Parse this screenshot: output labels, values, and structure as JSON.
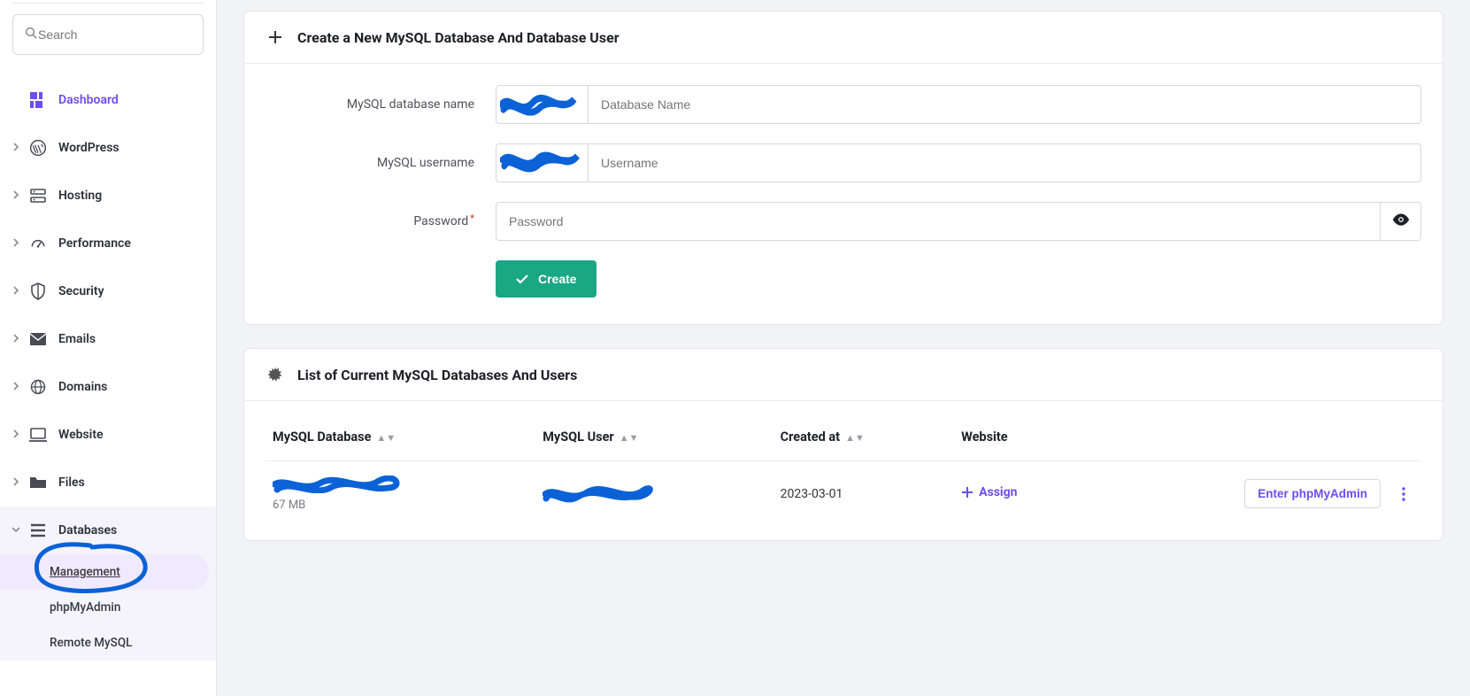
{
  "search": {
    "placeholder": "Search"
  },
  "sidebar": {
    "items": [
      {
        "label": "Dashboard"
      },
      {
        "label": "WordPress"
      },
      {
        "label": "Hosting"
      },
      {
        "label": "Performance"
      },
      {
        "label": "Security"
      },
      {
        "label": "Emails"
      },
      {
        "label": "Domains"
      },
      {
        "label": "Website"
      },
      {
        "label": "Files"
      },
      {
        "label": "Databases"
      }
    ],
    "databases_sub": [
      {
        "label": "Management"
      },
      {
        "label": "phpMyAdmin"
      },
      {
        "label": "Remote MySQL"
      }
    ]
  },
  "create": {
    "title": "Create a New MySQL Database And Database User",
    "fields": {
      "dbname_label": "MySQL database name",
      "dbname_placeholder": "Database Name",
      "username_label": "MySQL username",
      "username_placeholder": "Username",
      "password_label": "Password",
      "password_placeholder": "Password"
    },
    "button": "Create"
  },
  "list": {
    "title": "List of Current MySQL Databases And Users",
    "columns": {
      "db": "MySQL Database",
      "user": "MySQL User",
      "created": "Created at",
      "website": "Website"
    },
    "rows": [
      {
        "size": "67 MB",
        "created": "2023-03-01",
        "assign_label": "Assign",
        "enter_label": "Enter phpMyAdmin"
      }
    ]
  }
}
